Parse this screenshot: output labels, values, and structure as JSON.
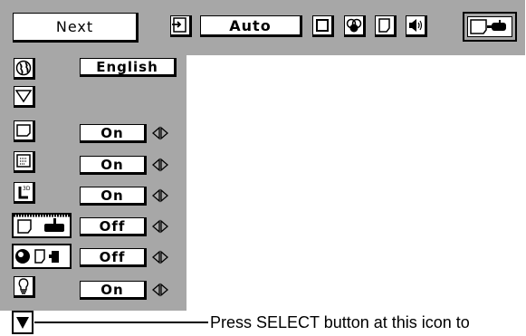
{
  "menubar": {
    "next_label": "Next",
    "mode_value": "Auto",
    "icons": [
      "input-icon",
      "screen-icon",
      "color-icon",
      "image-icon",
      "sound-icon",
      "setting-icon"
    ]
  },
  "settings": [
    {
      "icon": "globe-icon",
      "value": "English",
      "arrows": false
    },
    {
      "icon": "keystone-icon",
      "value": "",
      "arrows": false
    },
    {
      "icon": "display-icon",
      "value": "On",
      "arrows": true
    },
    {
      "icon": "menu-display-icon",
      "value": "On",
      "arrows": true
    },
    {
      "icon": "logo-icon",
      "value": "On",
      "arrows": true
    },
    {
      "icon": "ceiling-icon",
      "value": "Off",
      "arrows": true
    },
    {
      "icon": "rear-icon",
      "value": "Off",
      "arrows": true
    },
    {
      "icon": "lamp-icon",
      "value": "On",
      "arrows": true
    }
  ],
  "footer": {
    "caption": "Press SELECT button at this icon to",
    "down_icon": "down-arrow-icon"
  },
  "colors": {
    "panel": "#a7a7a7",
    "box": "#ffffff",
    "border": "#000000"
  }
}
